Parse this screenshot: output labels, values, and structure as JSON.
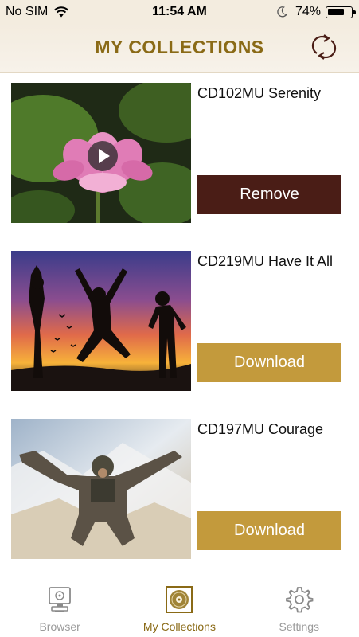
{
  "status_bar": {
    "carrier": "No SIM",
    "time": "11:54 AM",
    "battery_percent": "74%",
    "battery_level": 0.74
  },
  "header": {
    "title": "MY COLLECTIONS",
    "sync_icon": "sync-icon"
  },
  "collections": [
    {
      "title": "CD102MU Serenity",
      "action": "Remove",
      "thumbnail": "pink lotus flower with play button",
      "has_play": true
    },
    {
      "title": "CD219MU Have It All",
      "action": "Download",
      "thumbnail": "silhouettes jumping at sunset",
      "has_play": false
    },
    {
      "title": "CD197MU Courage",
      "action": "Download",
      "thumbnail": "skydiver in free fall over snowy mountains",
      "has_play": false
    }
  ],
  "tabbar": {
    "tabs": [
      {
        "label": "Browser",
        "icon": "computer-icon",
        "active": false
      },
      {
        "label": "My Collections",
        "icon": "cd-icon",
        "active": true
      },
      {
        "label": "Settings",
        "icon": "gear-icon",
        "active": false
      }
    ]
  },
  "colors": {
    "accent": "#8a6a16",
    "remove_button": "#4a1d16",
    "download_button": "#c39a3c",
    "header_bg": "#f3ecdf",
    "inactive_tab": "#9a9a9a"
  }
}
